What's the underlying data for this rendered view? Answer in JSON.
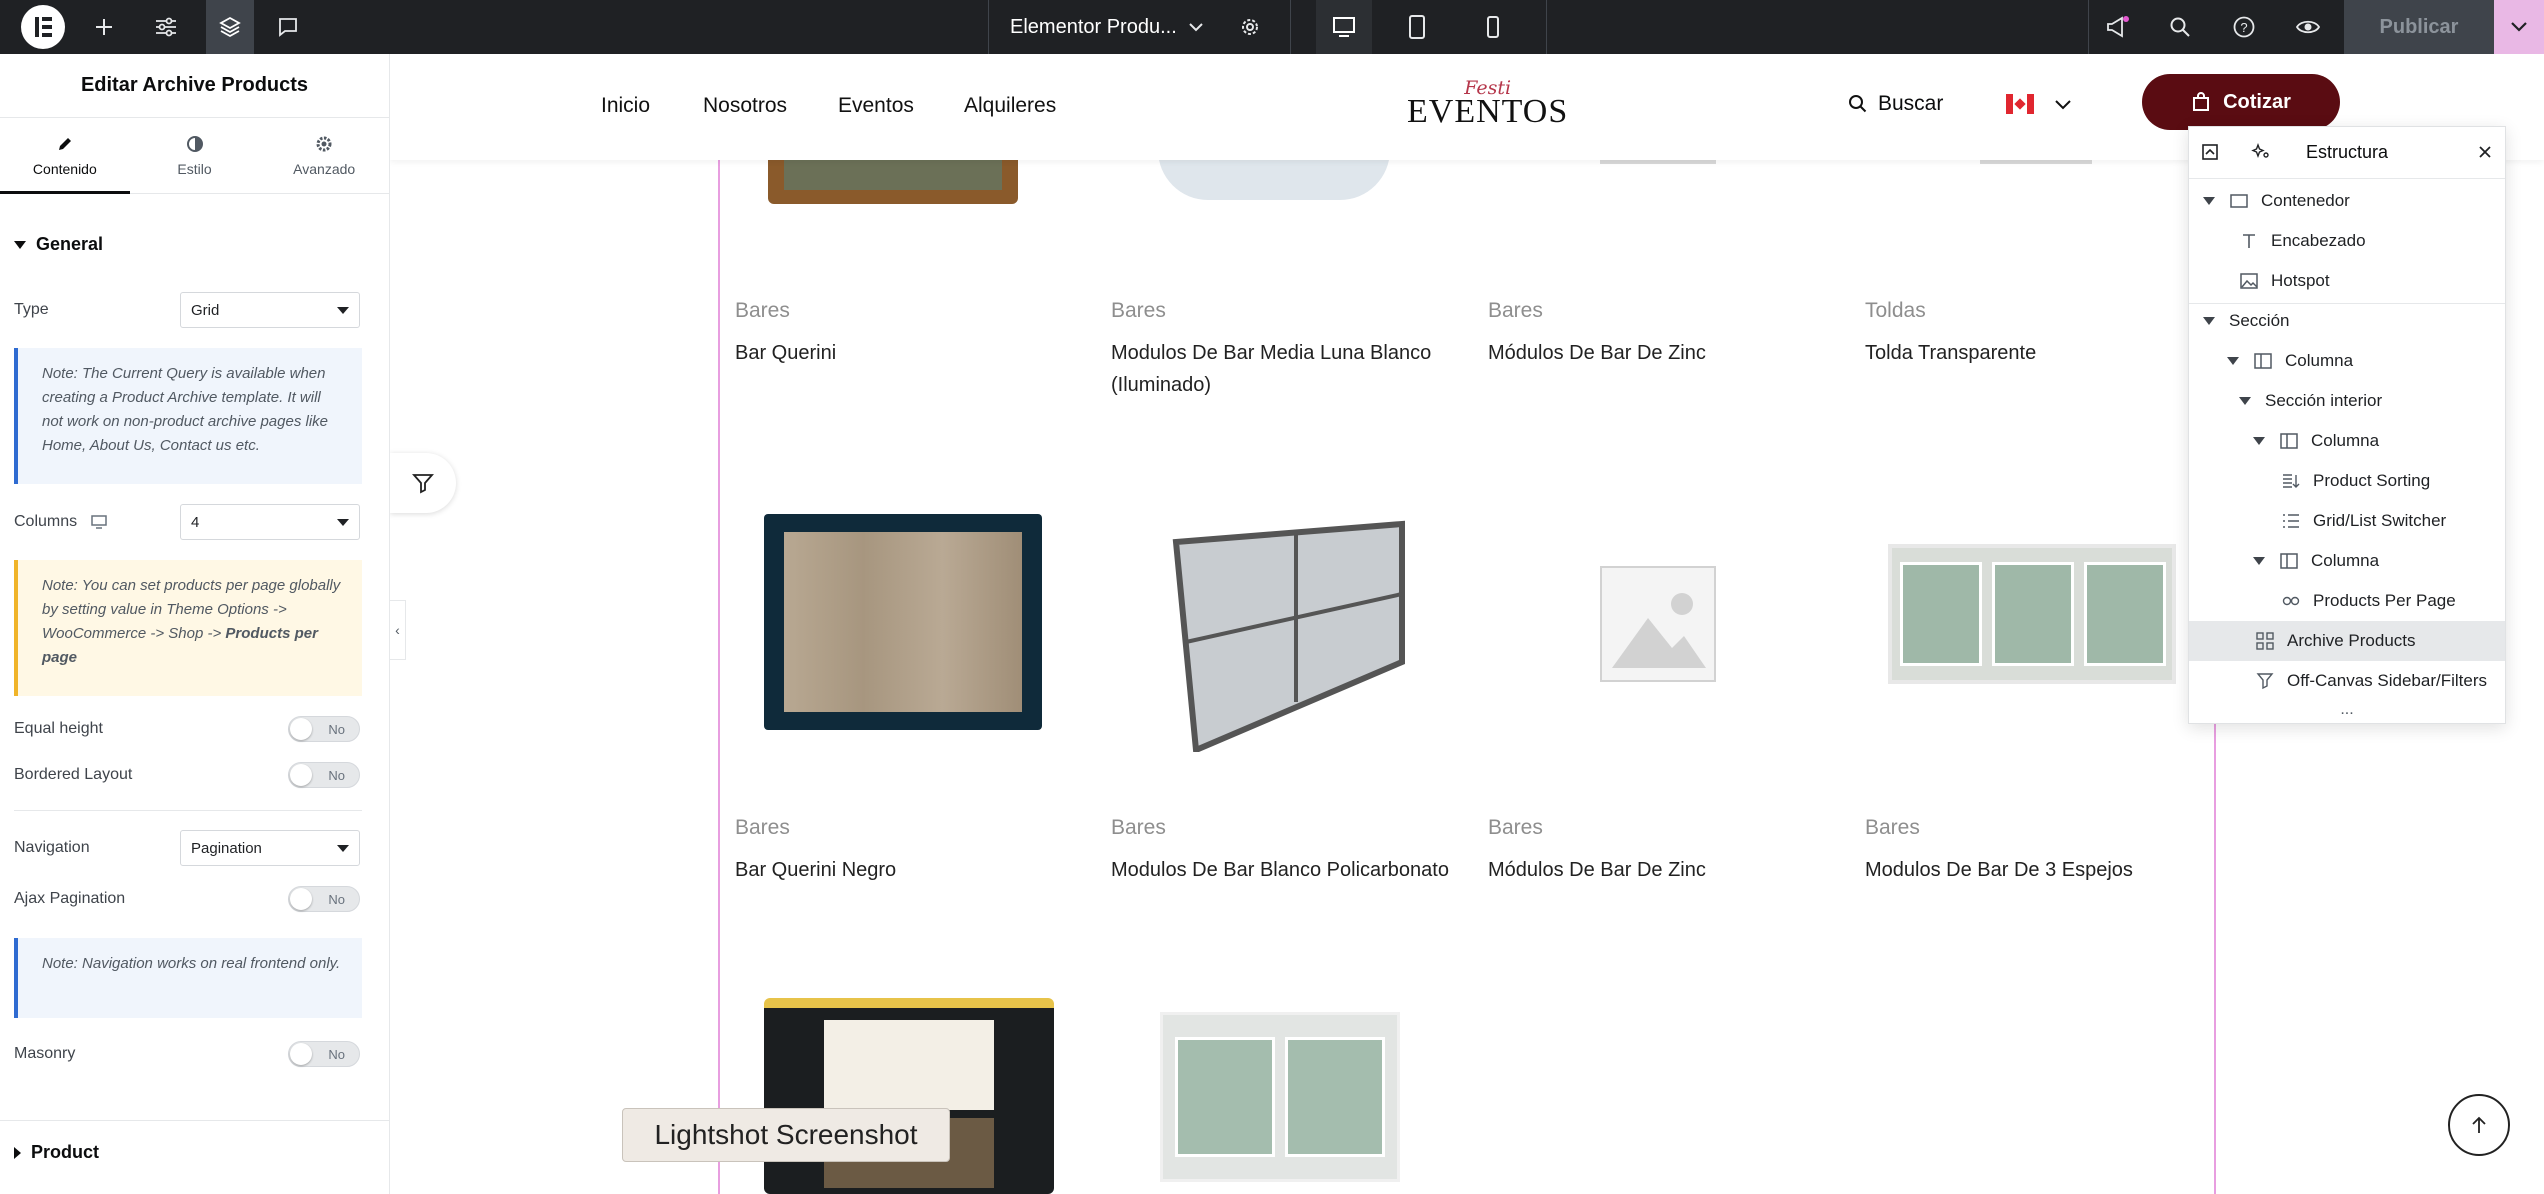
{
  "topbar": {
    "document_title": "Elementor Produ...",
    "publish_label": "Publicar"
  },
  "panel": {
    "title": "Editar Archive Products",
    "tabs": [
      {
        "label": "Contenido",
        "icon": "pencil-icon"
      },
      {
        "label": "Estilo",
        "icon": "half-circle-icon"
      },
      {
        "label": "Avanzado",
        "icon": "gear-icon"
      }
    ],
    "section_general": "General",
    "type_label": "Type",
    "type_value": "Grid",
    "note_query": "Note: The Current Query is available when creating a Product Archive template. It will not work on non-product archive pages like Home, About Us, Contact us etc.",
    "columns_label": "Columns",
    "columns_value": "4",
    "note_pp_prefix": "Note: You can set products per page globally by setting value in Theme Options -> WooCommerce -> Shop -> ",
    "note_pp_bold": "Products per page",
    "equal_height_label": "Equal height",
    "equal_height_value": "No",
    "bordered_label": "Bordered Layout",
    "bordered_value": "No",
    "navigation_label": "Navigation",
    "navigation_value": "Pagination",
    "ajax_label": "Ajax Pagination",
    "ajax_value": "No",
    "note_nav": "Note: Navigation works on real frontend only.",
    "masonry_label": "Masonry",
    "masonry_value": "No",
    "section_product": "Product"
  },
  "site": {
    "nav": [
      "Inicio",
      "Nosotros",
      "Eventos",
      "Alquileres"
    ],
    "logo_script": "Festi",
    "logo_main": "EVENTOS",
    "search_label": "Buscar",
    "cta_label": "Cotizar"
  },
  "products": [
    {
      "category": "Bares",
      "name": "Bar Querini"
    },
    {
      "category": "Bares",
      "name": "Modulos De Bar Media Luna Blanco (Iluminado)"
    },
    {
      "category": "Bares",
      "name": "Módulos De Bar De Zinc"
    },
    {
      "category": "Toldas",
      "name": "Tolda Transparente"
    },
    {
      "category": "Bares",
      "name": "Bar Querini Negro"
    },
    {
      "category": "Bares",
      "name": "Modulos De Bar Blanco Policarbonato"
    },
    {
      "category": "Bares",
      "name": "Módulos De Bar De Zinc"
    },
    {
      "category": "Bares",
      "name": "Modulos De Bar De 3 Espejos"
    }
  ],
  "structure": {
    "title": "Estructura",
    "items": [
      {
        "label": "Contenedor",
        "icon": "container-icon"
      },
      {
        "label": "Encabezado",
        "icon": "heading-icon"
      },
      {
        "label": "Hotspot",
        "icon": "image-icon"
      },
      {
        "label": "Sección",
        "icon": ""
      },
      {
        "label": "Columna",
        "icon": "column-icon"
      },
      {
        "label": "Sección interior",
        "icon": ""
      },
      {
        "label": "Columna",
        "icon": "column-icon"
      },
      {
        "label": "Product Sorting",
        "icon": "sort-icon"
      },
      {
        "label": "Grid/List Switcher",
        "icon": "list-icon"
      },
      {
        "label": "Columna",
        "icon": "column-icon"
      },
      {
        "label": "Products Per Page",
        "icon": "per-page-icon"
      },
      {
        "label": "Archive Products",
        "icon": "grid-icon"
      },
      {
        "label": "Off-Canvas Sidebar/Filters",
        "icon": "filter-icon"
      }
    ],
    "more": "..."
  },
  "overlay": {
    "lightshot": "Lightshot Screenshot"
  }
}
